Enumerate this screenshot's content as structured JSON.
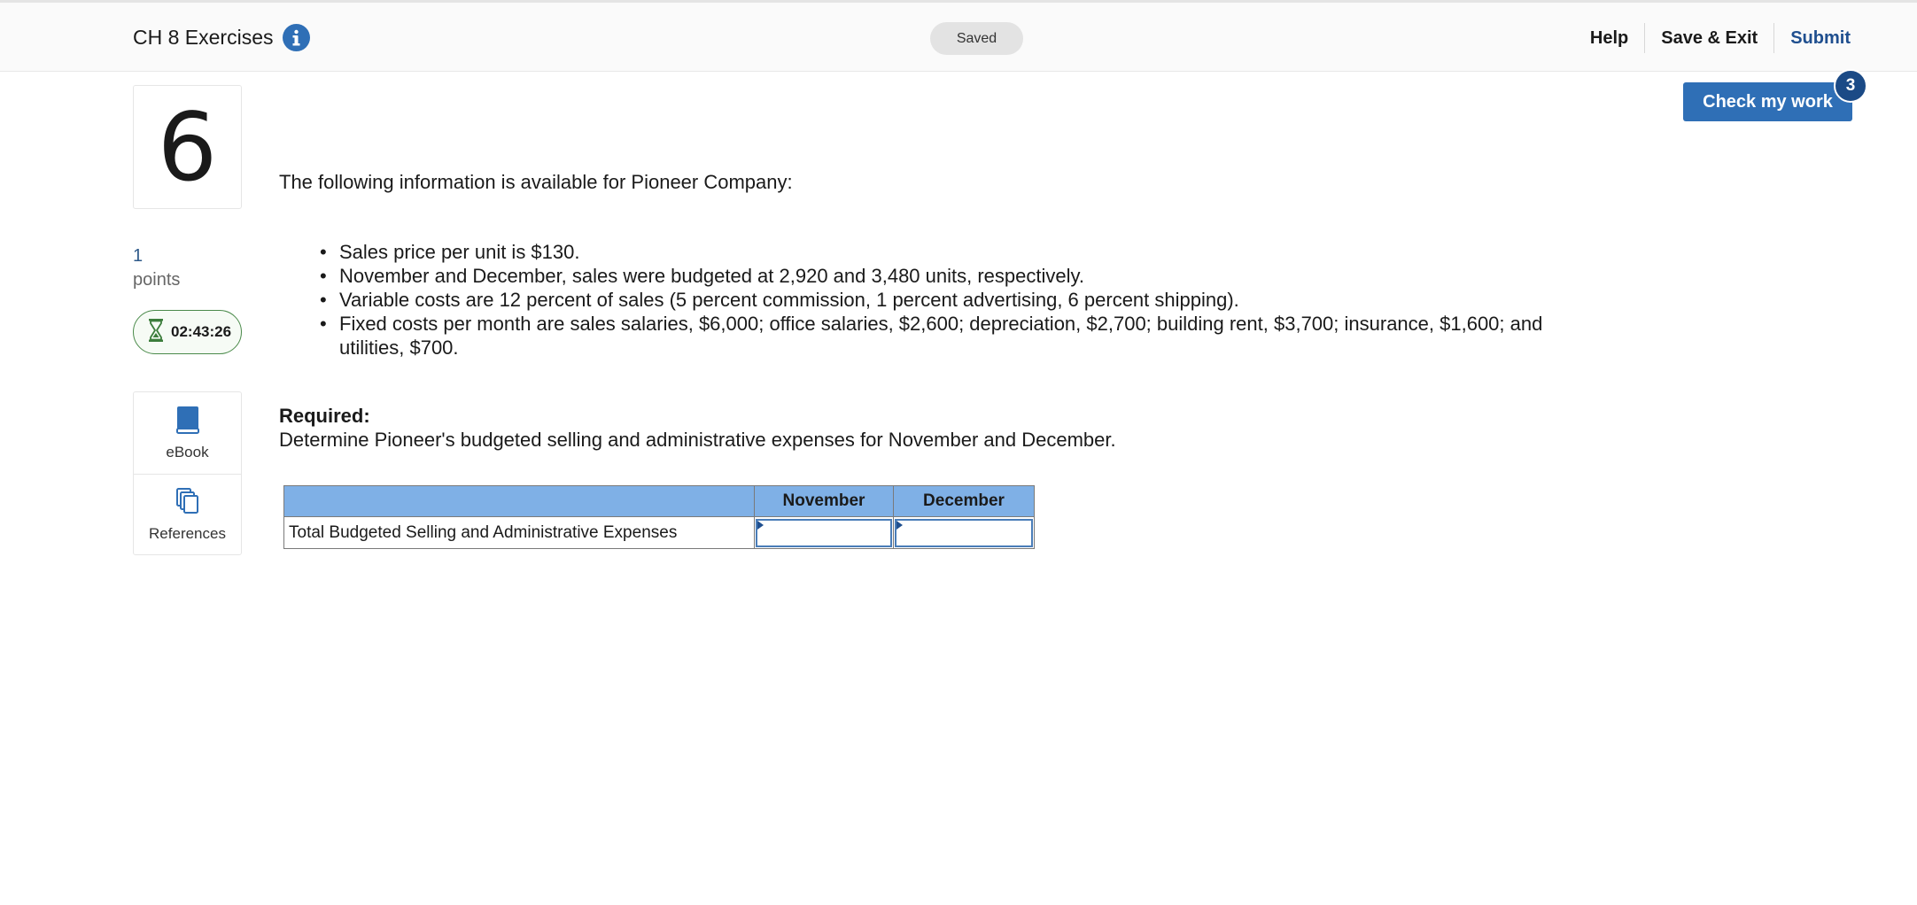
{
  "header": {
    "title": "CH 8 Exercises",
    "saved_status": "Saved",
    "nav": {
      "help": "Help",
      "save_exit": "Save & Exit",
      "submit": "Submit"
    }
  },
  "sidebar": {
    "question_number": "6",
    "points_value": "1",
    "points_label": "points",
    "timer": "02:43:26",
    "resources": [
      {
        "label": "eBook",
        "icon": "book-icon"
      },
      {
        "label": "References",
        "icon": "copy-pages-icon"
      }
    ]
  },
  "check_my_work": {
    "label": "Check my work",
    "badge": "3"
  },
  "question": {
    "intro": "The following information is available for Pioneer Company:",
    "bullets": [
      "Sales price per unit is $130.",
      "November and December, sales were budgeted at 2,920 and 3,480 units, respectively.",
      "Variable costs are 12 percent of sales (5 percent commission, 1 percent advertising, 6 percent shipping).",
      "Fixed costs per month are sales salaries, $6,000; office salaries, $2,600; depreciation, $2,700; building rent, $3,700; insurance, $1,600; and utilities, $700."
    ],
    "required_heading": "Required:",
    "required_text": "Determine Pioneer's budgeted selling and administrative expenses for November and December."
  },
  "table": {
    "headers": [
      "",
      "November",
      "December"
    ],
    "row_label": "Total Budgeted Selling and Administrative Expenses",
    "inputs": {
      "november": "",
      "december": ""
    }
  },
  "colors": {
    "accent": "#2f6fb6",
    "badge": "#1b4a86",
    "table_header": "#7fb0e6",
    "submit_link": "#1f4f8f",
    "timer_border": "#4a8a4a"
  }
}
